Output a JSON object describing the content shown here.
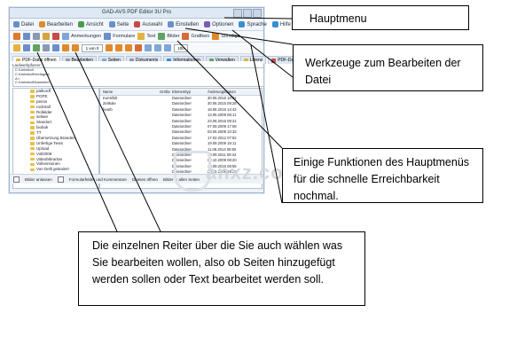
{
  "app": {
    "title": "GAD-AVS PDF Editor 3U Pro",
    "menu": [
      {
        "label": "Datei",
        "color": "#6a8fc9"
      },
      {
        "label": "Bearbeiten",
        "color": "#e08a2c"
      },
      {
        "label": "Ansicht",
        "color": "#4c9b4c"
      },
      {
        "label": "Seite",
        "color": "#6a8fc9"
      },
      {
        "label": "Auswahl",
        "color": "#c64a4a"
      },
      {
        "label": "Einstellen",
        "color": "#6a8fc9"
      },
      {
        "label": "Optionen",
        "color": "#7a5bb6"
      },
      {
        "label": "Sprache",
        "color": "#3b8fd1"
      },
      {
        "label": "Hilfe",
        "color": "#3b8fd1"
      }
    ],
    "toolbar": {
      "anmerkungen": "Anmerkungen",
      "formulare": "Formulare",
      "text": "Text",
      "bilder": "Bilder",
      "grafiken": "Grafiken",
      "sonstige": "Sonstige"
    },
    "toolbar2": {
      "page_value": "1 von 0",
      "zoom_value": "100"
    },
    "tabs": [
      {
        "label": "PDF-Datei öffnen",
        "active": true
      },
      {
        "label": "Bearbeiten"
      },
      {
        "label": "Seiten"
      },
      {
        "label": "Dokuments"
      },
      {
        "label": "Informationen"
      },
      {
        "label": "Verwalten"
      },
      {
        "label": "Lizenz"
      },
      {
        "label": "PDF-Datei speichern"
      }
    ],
    "dir_label": "Laufwerkpfarrer:",
    "dir_lines": [
      "C:\\Unbekoll",
      "C:\\Unbekoll\\Vorlagen\\",
      "A:\\",
      "C:\\Unbekoll\\Sammler\\"
    ],
    "tree": [
      "palkordf",
      "POPE",
      "penns",
      "rocktrall",
      "Rollelder",
      "selsee",
      "Standort",
      "biobuk",
      "TT",
      "Übersetzung Branden",
      "Unfertige Tests",
      "Upload",
      "Voll2009",
      "Videobibrartan",
      "Vollversionen",
      "Von Delli geändert"
    ],
    "file_headers": {
      "name": "Name",
      "size": "Größe",
      "type": "Elementtyp",
      "date": "Änderungsdatum"
    },
    "files": [
      {
        "name": "Kunstfolt",
        "type": "Dateiordner",
        "date": "30.06.2015 10:01"
      },
      {
        "name": "Zeitkale",
        "type": "Dateiordner",
        "date": "30.06.2015 08:28"
      },
      {
        "name": "bearb",
        "type": "Dateiordner",
        "date": "18.08.2016 14:42"
      },
      {
        "name": "",
        "type": "Dateiordner",
        "date": "13.06.2009 08:11"
      },
      {
        "name": "",
        "type": "Dateiordner",
        "date": "23.06.2015 08:21"
      },
      {
        "name": "",
        "type": "Dateiordner",
        "date": "07.09.2009 17:08"
      },
      {
        "name": "",
        "type": "Dateiordner",
        "date": "03.06.2009 10:33"
      },
      {
        "name": "",
        "type": "Dateiordner",
        "date": "17.02.2012 07:52"
      },
      {
        "name": "",
        "type": "Dateiordner",
        "date": "19.09.2009 19:11"
      },
      {
        "name": "",
        "type": "Dateiordner",
        "date": "11.08.2014 08:55"
      },
      {
        "name": "",
        "type": "Dateiordner",
        "date": "13.09.2011 09:44"
      },
      {
        "name": "",
        "type": "Dateiordner",
        "date": "02.10.2009 08:20"
      },
      {
        "name": "",
        "type": "Dateiordner",
        "date": "15.09.2016 08:55"
      },
      {
        "name": "",
        "type": "Dateiordner",
        "date": "20.12.2009 18:26"
      },
      {
        "name": "",
        "type": "Dateiordner",
        "date": "04.09.2010 18:06"
      }
    ],
    "status": {
      "check1": "Bilder anlassen",
      "check2": "Formularfelder und Kommentare",
      "text3": "Dateien öffnen",
      "text4": "Bilder in allen Seiten"
    }
  },
  "callouts": {
    "hauptmenu": "Hauptmenu",
    "werkzeuge": "Werkzeuge zum Bearbeiten der Datei",
    "funktionen": "Einige Funktionen des Hauptmenüs für die schnelle Erreichbarkeit nochmal.",
    "reiter": "Die einzelnen Reiter über die Sie auch wählen was Sie bearbeiten wollen, also ob Seiten hinzugefügt werden sollen oder Text bearbeitet werden soll."
  },
  "watermark": "anxz.com"
}
